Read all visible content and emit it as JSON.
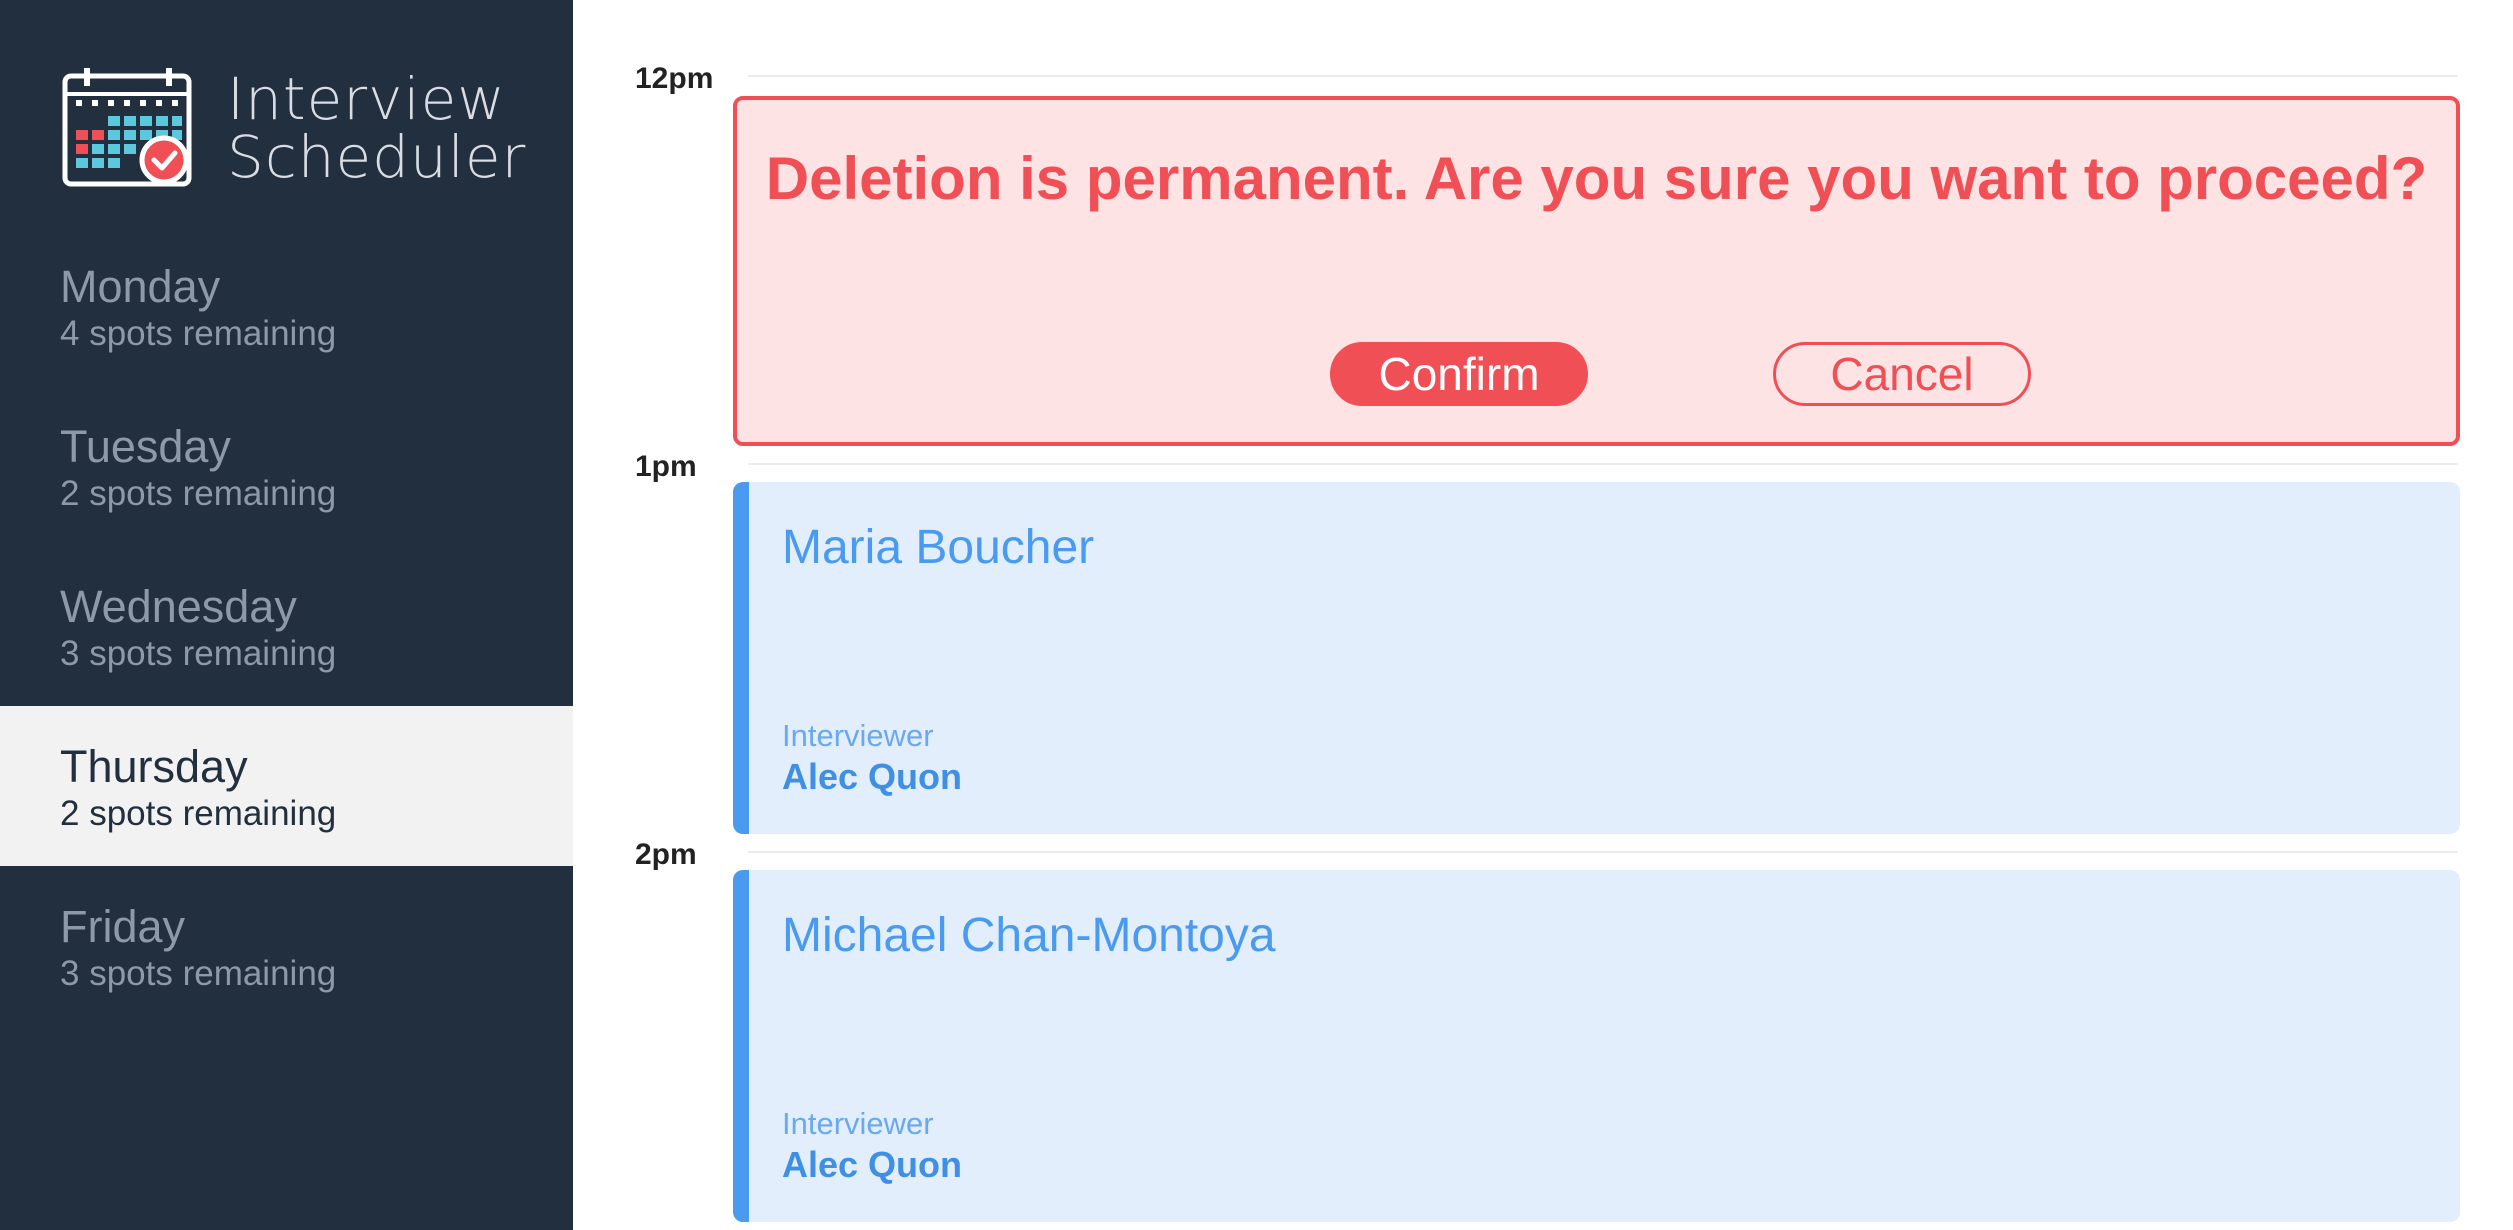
{
  "brand": {
    "title_line1": "Interview",
    "title_line2": "Scheduler",
    "logo_icon": "calendar-check-icon",
    "colors": {
      "red": "#ef4f55",
      "teal": "#5bc8de",
      "frame": "#ffffff"
    }
  },
  "sidebar": {
    "days": [
      {
        "name": "Monday",
        "spots": "4 spots remaining"
      },
      {
        "name": "Tuesday",
        "spots": "2 spots remaining"
      },
      {
        "name": "Wednesday",
        "spots": "3 spots remaining"
      },
      {
        "name": "Thursday",
        "spots": "2 spots remaining",
        "selected": true
      },
      {
        "name": "Friday",
        "spots": "3 spots remaining"
      }
    ]
  },
  "schedule": {
    "times": [
      "12pm",
      "1pm",
      "2pm"
    ],
    "confirm": {
      "message": "Deletion is permanent. Are you sure you want to proceed?",
      "confirm_label": "Confirm",
      "cancel_label": "Cancel"
    },
    "appointments": [
      {
        "student": "Maria Boucher",
        "interviewer_label": "Interviewer",
        "interviewer": "Alec Quon"
      },
      {
        "student": "Michael Chan-Montoya",
        "interviewer_label": "Interviewer",
        "interviewer": "Alec Quon"
      }
    ]
  },
  "colors": {
    "sidebar_bg": "#222f3e",
    "selected_bg": "#f2f2f2",
    "danger": "#ef4f55",
    "danger_bg": "#fde3e3",
    "appointment_bg": "#e2eefc",
    "appointment_accent": "#4a9bef"
  }
}
